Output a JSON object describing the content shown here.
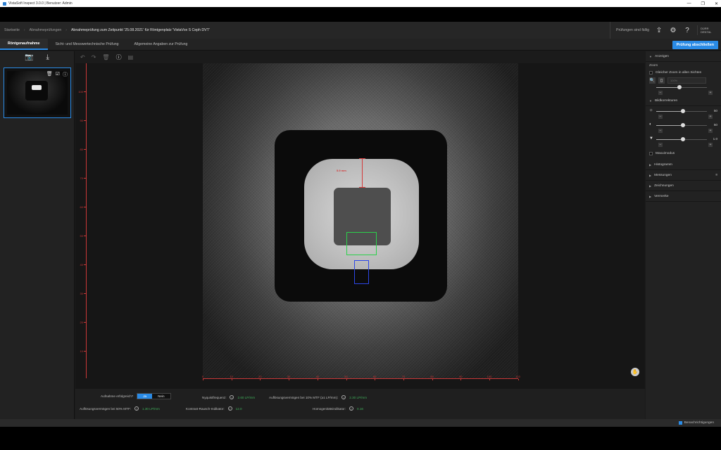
{
  "window": {
    "title": "VistaSoft Inspect 3.0.0 | Benutzer: Admin"
  },
  "breadcrumb": {
    "items": [
      "Startseite",
      "Abnahmeprüfungen"
    ],
    "current": "Abnahmeprüfung zum Zeitpunkt '25.08.2021' für Röntgenplatz 'VistaVox S Ceph DVT'"
  },
  "header": {
    "status": "Prüfungen sind fällig",
    "logo_text": "DÜRR DENTAL"
  },
  "tabs": [
    {
      "label": "Röntgenaufnahme",
      "active": true
    },
    {
      "label": "Sicht- und Messwertechnische Prüfung",
      "active": false
    },
    {
      "label": "Allgemeine Angaben zur Prüfung",
      "active": false
    }
  ],
  "finish_button": "Prüfung abschließen",
  "image": {
    "measurement_label": "5.9 mm",
    "y_ticks": [
      "100",
      "90",
      "80",
      "70",
      "60",
      "50",
      "40",
      "30",
      "20",
      "10"
    ],
    "x_ticks": [
      "0",
      "10",
      "20",
      "30",
      "40",
      "50",
      "60",
      "70",
      "80",
      "90",
      "100",
      "110"
    ]
  },
  "bottom": {
    "question": "Aufnahme erfolgreich?",
    "yes": "Ja",
    "no": "Nein",
    "nyquist_label": "Nyquistfrequenz:",
    "nyquist_value": "2.60 LP/mm",
    "mtf10_label": "Auflösungsvermögen bei 10% MTF (≥1 LP/mm):",
    "mtf10_value": "2.30 LP/mm",
    "mtf50_label": "Auflösungsvermögen bei 50% MTF:",
    "mtf50_value": "1.30 LP/mm",
    "cnr_label": "Kontrast-Rausch-Indikator:",
    "cnr_value": "12.0",
    "homog_label": "Homogenitätsindikator:",
    "homog_value": "0.16"
  },
  "right_panel": {
    "section_display": "Anzeigen",
    "zoom_label": "Zoom",
    "same_zoom": "Gleicher Zoom in allen Sichten",
    "zoom_select": "100%",
    "section_corrections": "Bildkorrekturen",
    "brightness_value": "50",
    "contrast_value": "50",
    "filter_value": "1.0",
    "grayscale_label": "Maxuimodus",
    "collapsed": [
      "Histogramm",
      "Messungen",
      "Zeichnungen",
      "Vermerke"
    ]
  },
  "statusbar": {
    "notifications": "Benachrichtigungen"
  }
}
